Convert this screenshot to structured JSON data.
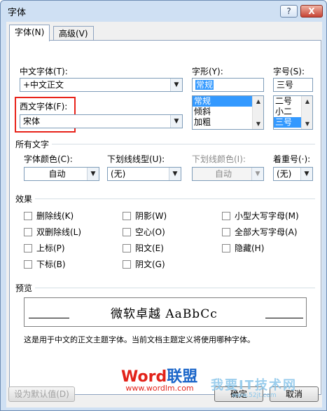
{
  "window": {
    "title": "字体",
    "help_glyph": "?",
    "close_glyph": "X"
  },
  "tabs": [
    {
      "label": "字体(N)",
      "active": true
    },
    {
      "label": "高级(V)",
      "active": false
    }
  ],
  "font": {
    "chinese_label": "中文字体(T):",
    "chinese_value": "+中文正文",
    "western_label": "西文字体(F):",
    "western_value": "宋体",
    "style_label": "字形(Y):",
    "style_value": "常规",
    "style_options": [
      "常规",
      "倾斜",
      "加粗"
    ],
    "size_label": "字号(S):",
    "size_value": "三号",
    "size_options": [
      "二号",
      "小二",
      "三号"
    ]
  },
  "all_text": {
    "heading": "所有文字",
    "color_label": "字体颜色(C):",
    "color_value": "自动",
    "underline_label": "下划线线型(U):",
    "underline_value": "(无)",
    "underline_color_label": "下划线颜色(I):",
    "underline_color_value": "自动",
    "emphasis_label": "着重号(·):",
    "emphasis_value": "(无)"
  },
  "effects": {
    "heading": "效果",
    "col1": [
      "删除线(K)",
      "双删除线(L)",
      "上标(P)",
      "下标(B)"
    ],
    "col2": [
      "阴影(W)",
      "空心(O)",
      "阳文(E)",
      "阴文(G)"
    ],
    "col3": [
      "小型大写字母(M)",
      "全部大写字母(A)",
      "隐藏(H)"
    ]
  },
  "preview": {
    "heading": "预览",
    "sample": "微软卓越  AaBbCc",
    "note": "这是用于中文的正文主题字体。当前文档主题定义将使用哪种字体。"
  },
  "buttons": {
    "default": "设为默认值(D)",
    "ok": "确定",
    "cancel": "取消"
  },
  "watermark": {
    "brand_a": "Word",
    "brand_b": "联盟",
    "url": "www.wordlm.com",
    "brand2": "我要IT技术网",
    "url2": "www.52jt.com"
  },
  "colors": {
    "highlight_box": "#e8231a",
    "selection": "#3399ff"
  }
}
